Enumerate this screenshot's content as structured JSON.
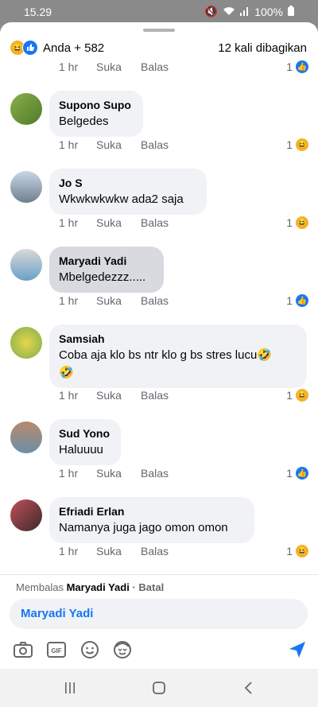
{
  "status": {
    "time": "15.29",
    "battery": "100%"
  },
  "header": {
    "reactions_text": "Anda + 582",
    "shares": "12 kali dibagikan"
  },
  "top_row": {
    "time": "1 hr",
    "like": "Suka",
    "reply": "Balas",
    "count": "1",
    "reaction": "like"
  },
  "comments": [
    {
      "name": "Supono Supo",
      "text": "Belgedes",
      "time": "1 hr",
      "like": "Suka",
      "reply": "Balas",
      "count": "1",
      "reaction": "haha",
      "avatar": "green"
    },
    {
      "name": "Jo S",
      "text": "Wkwkwkwkw ada2 saja",
      "time": "1 hr",
      "like": "Suka",
      "reply": "Balas",
      "count": "1",
      "reaction": "haha",
      "avatar": "building"
    },
    {
      "name": "Maryadi Yadi",
      "text": "Mbelgedezzz.....",
      "time": "1 hr",
      "like": "Suka",
      "reply": "Balas",
      "count": "1",
      "reaction": "like",
      "avatar": "person",
      "selected": true
    },
    {
      "name": "Samsiah",
      "text": "Coba aja klo bs ntr klo g bs stres lucu🤣",
      "text2": "🤣",
      "time": "1 hr",
      "like": "Suka",
      "reply": "Balas",
      "count": "1",
      "reaction": "haha",
      "avatar": "cartoon"
    },
    {
      "name": "Sud Yono",
      "text": "Haluuuu",
      "time": "1 hr",
      "like": "Suka",
      "reply": "Balas",
      "count": "1",
      "reaction": "like",
      "avatar": "room"
    },
    {
      "name": "Efriadi Erlan",
      "text": "Namanya juga jago omon omon",
      "time": "1 hr",
      "like": "Suka",
      "reply": "Balas",
      "count": "1",
      "reaction": "haha",
      "avatar": "couple"
    }
  ],
  "reply": {
    "prefix": "Membalas",
    "name": "Maryadi Yadi",
    "cancel": "· Batal",
    "input_mention": "Maryadi Yadi"
  },
  "colors": {
    "blue": "#1877f2",
    "haha": "#f7b125",
    "bubble": "#f0f2f5"
  }
}
